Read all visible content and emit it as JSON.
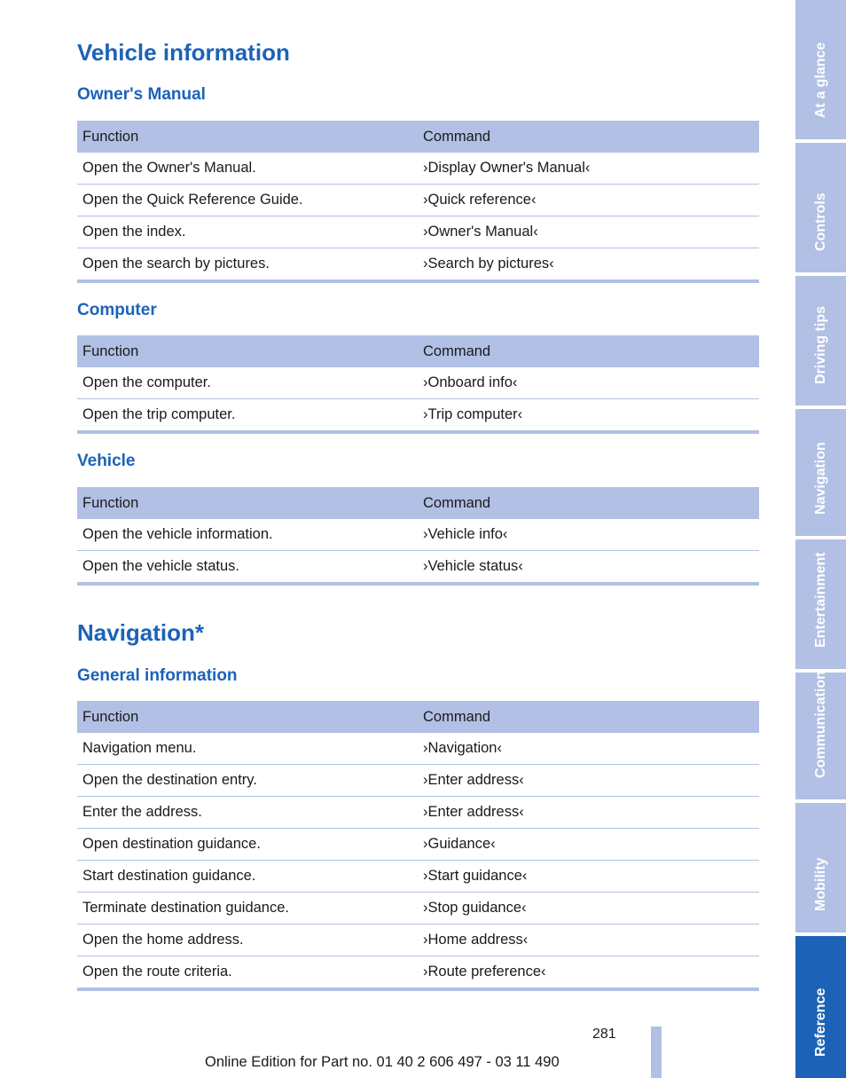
{
  "sections": [
    {
      "title": "Vehicle information",
      "subsections": [
        {
          "title": "Owner's Manual",
          "headers": [
            "Function",
            "Command"
          ],
          "rows": [
            [
              "Open the Owner's Manual.",
              "›Display Owner's Manual‹"
            ],
            [
              "Open the Quick Reference Guide.",
              "›Quick reference‹"
            ],
            [
              "Open the index.",
              "›Owner's Manual‹"
            ],
            [
              "Open the search by pictures.",
              "›Search by pictures‹"
            ]
          ]
        },
        {
          "title": "Computer",
          "headers": [
            "Function",
            "Command"
          ],
          "rows": [
            [
              "Open the computer.",
              "›Onboard info‹"
            ],
            [
              "Open the trip computer.",
              "›Trip computer‹"
            ]
          ]
        },
        {
          "title": "Vehicle",
          "headers": [
            "Function",
            "Command"
          ],
          "rows": [
            [
              "Open the vehicle information.",
              "›Vehicle info‹"
            ],
            [
              "Open the vehicle status.",
              "›Vehicle status‹"
            ]
          ]
        }
      ]
    },
    {
      "title": "Navigation*",
      "subsections": [
        {
          "title": "General information",
          "headers": [
            "Function",
            "Command"
          ],
          "rows": [
            [
              "Navigation menu.",
              "›Navigation‹"
            ],
            [
              "Open the destination entry.",
              "›Enter address‹"
            ],
            [
              "Enter the address.",
              "›Enter address‹"
            ],
            [
              "Open destination guidance.",
              "›Guidance‹"
            ],
            [
              "Start destination guidance.",
              "›Start guidance‹"
            ],
            [
              "Terminate destination guidance.",
              "›Stop guidance‹"
            ],
            [
              "Open the home address.",
              "›Home address‹"
            ],
            [
              "Open the route criteria.",
              "›Route preference‹"
            ]
          ]
        }
      ]
    }
  ],
  "side_tabs": [
    {
      "label": "At a glance",
      "active": false
    },
    {
      "label": "Controls",
      "active": false
    },
    {
      "label": "Driving tips",
      "active": false
    },
    {
      "label": "Navigation",
      "active": false
    },
    {
      "label": "Entertainment",
      "active": false
    },
    {
      "label": "Communication",
      "active": false
    },
    {
      "label": "Mobility",
      "active": false
    },
    {
      "label": "Reference",
      "active": true
    }
  ],
  "page_number": "281",
  "footer": "Online Edition for Part no. 01 40 2 606 497 - 03 11 490",
  "colors": {
    "accent": "#1c63b7",
    "table_tint": "#b1c0e4"
  }
}
